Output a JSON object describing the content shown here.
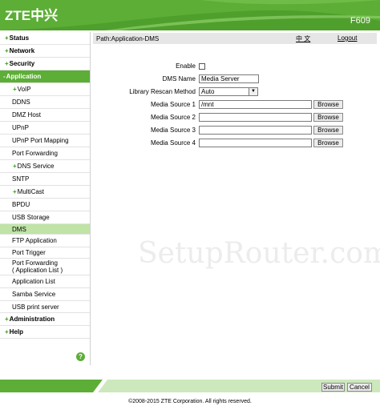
{
  "header": {
    "logo": "ZTE中兴",
    "model": "F609",
    "colors": {
      "brand_green": "#5cae36",
      "selected_green": "#bfe4a6"
    }
  },
  "sidebar": {
    "items": [
      {
        "label": "Status",
        "prefix": "+"
      },
      {
        "label": "Network",
        "prefix": "+"
      },
      {
        "label": "Security",
        "prefix": "+"
      },
      {
        "label": "Application",
        "prefix": "-"
      },
      {
        "label": "VoIP",
        "prefix": "+"
      },
      {
        "label": "DDNS"
      },
      {
        "label": "DMZ Host"
      },
      {
        "label": "UPnP"
      },
      {
        "label": "UPnP Port Mapping"
      },
      {
        "label": "Port Forwarding"
      },
      {
        "label": "DNS Service",
        "prefix": "+"
      },
      {
        "label": "SNTP"
      },
      {
        "label": "MultiCast",
        "prefix": "+"
      },
      {
        "label": "BPDU"
      },
      {
        "label": "USB Storage"
      },
      {
        "label": "DMS"
      },
      {
        "label": "FTP Application"
      },
      {
        "label": "Port Trigger"
      },
      {
        "label": "Port Forwarding",
        "label2": "( Application List )"
      },
      {
        "label": "Application List"
      },
      {
        "label": "Samba Service"
      },
      {
        "label": "USB print server"
      },
      {
        "label": "Administration",
        "prefix": "+"
      },
      {
        "label": "Help",
        "prefix": "+"
      }
    ],
    "help_icon_glyph": "?"
  },
  "pathbar": {
    "path": "Path:Application-DMS",
    "lang": "中 文",
    "logout": "Logout"
  },
  "form": {
    "enable_label": "Enable",
    "enable_checked": false,
    "dms_name_label": "DMS Name",
    "dms_name_value": "Media Server",
    "rescan_label": "Library Rescan Method",
    "rescan_value": "Auto",
    "select_arrow_glyph": "▼",
    "sources": [
      {
        "label": "Media Source 1",
        "value": "/mnt"
      },
      {
        "label": "Media Source 2",
        "value": ""
      },
      {
        "label": "Media Source 3",
        "value": ""
      },
      {
        "label": "Media Source 4",
        "value": ""
      }
    ],
    "browse_label": "Browse"
  },
  "watermark": "SetupRouter.com",
  "footer": {
    "submit": "Submit",
    "cancel": "Cancel",
    "copyright": "©2008-2015 ZTE Corporation. All rights reserved."
  }
}
